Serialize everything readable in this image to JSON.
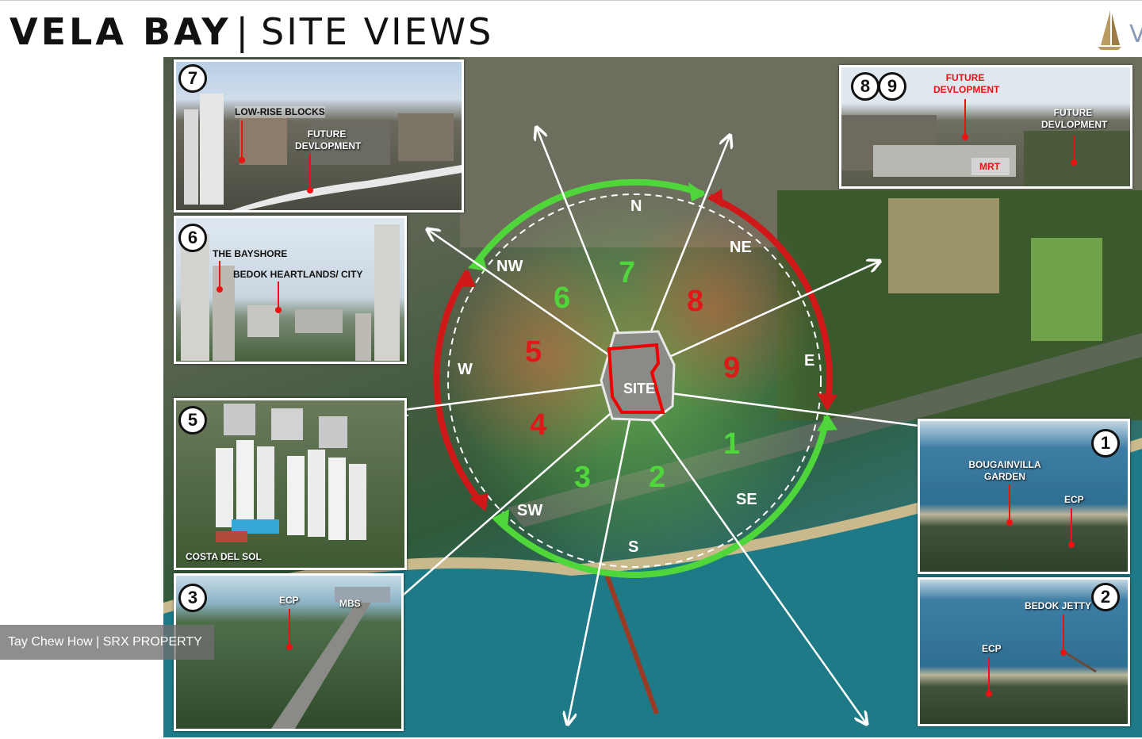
{
  "header": {
    "brand": "VELA BAY",
    "separator": "|",
    "section": "SITE VIEWS",
    "logo_icon": "sail-logo-icon",
    "logo_partial_text": "V"
  },
  "map": {
    "site_label": "SITE",
    "directions": {
      "n": "N",
      "ne": "NE",
      "e": "E",
      "se": "SE",
      "s": "S",
      "sw": "SW",
      "w": "W",
      "nw": "NW"
    },
    "sector_numbers": [
      "1",
      "2",
      "3",
      "4",
      "5",
      "6",
      "7",
      "8",
      "9"
    ],
    "colors": {
      "favourable": "#4ed63a",
      "unfavourable": "#d01818",
      "compass_ring": "#ffffff"
    }
  },
  "photos": {
    "p7": {
      "num": "7",
      "labels": [
        "LOW-RISE BLOCKS",
        "FUTURE DEVLOPMENT"
      ]
    },
    "p6": {
      "num": "6",
      "labels": [
        "THE BAYSHORE",
        "BEDOK HEARTLANDS/ CITY"
      ]
    },
    "p5": {
      "num": "5",
      "labels": [
        "COSTA DEL SOL"
      ]
    },
    "p3": {
      "num": "3",
      "labels": [
        "ECP",
        "MBS"
      ]
    },
    "p89": {
      "num_a": "8",
      "num_b": "9",
      "labels": [
        "FUTURE DEVLOPMENT",
        "FUTURE DEVLOPMENT",
        "MRT"
      ]
    },
    "p1": {
      "num": "1",
      "labels": [
        "BOUGAINVILLA GARDEN",
        "ECP"
      ]
    },
    "p2": {
      "num": "2",
      "labels": [
        "BEDOK JETTY",
        "ECP"
      ]
    }
  },
  "watermark": "Tay Chew How | SRX PROPERTY"
}
